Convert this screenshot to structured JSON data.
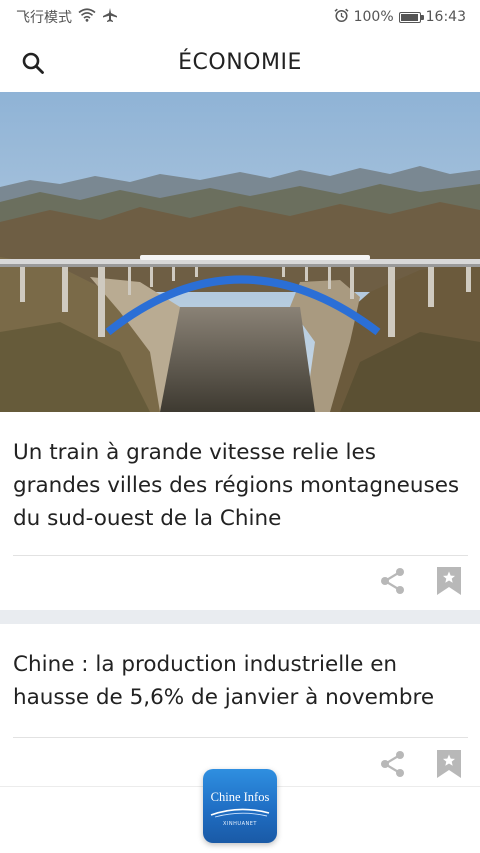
{
  "status_bar": {
    "carrier": "飞行模式",
    "battery": "100%",
    "battery_level": 1.0,
    "time": "16:43"
  },
  "header": {
    "title": "ÉCONOMIE"
  },
  "articles": [
    {
      "title": "Un train à grande vitesse relie les grandes villes des régions montagneuses du sud-ouest de la Chine"
    },
    {
      "title": "Chine : la production industrielle en hausse de 5,6% de janvier à novembre"
    }
  ],
  "app_logo": {
    "title": "Chine Infos",
    "subtitle": "XINHUANET"
  },
  "icons": {
    "search": "search-icon",
    "wifi": "wifi-icon",
    "airplane": "airplane-icon",
    "alarm": "alarm-icon",
    "battery": "battery-icon",
    "share": "share-icon",
    "bookmark": "bookmark-star-icon"
  },
  "colors": {
    "accent": "#1f6ec4",
    "icon_gray": "#b8b8b8",
    "section_gap": "#e9ecf0"
  }
}
